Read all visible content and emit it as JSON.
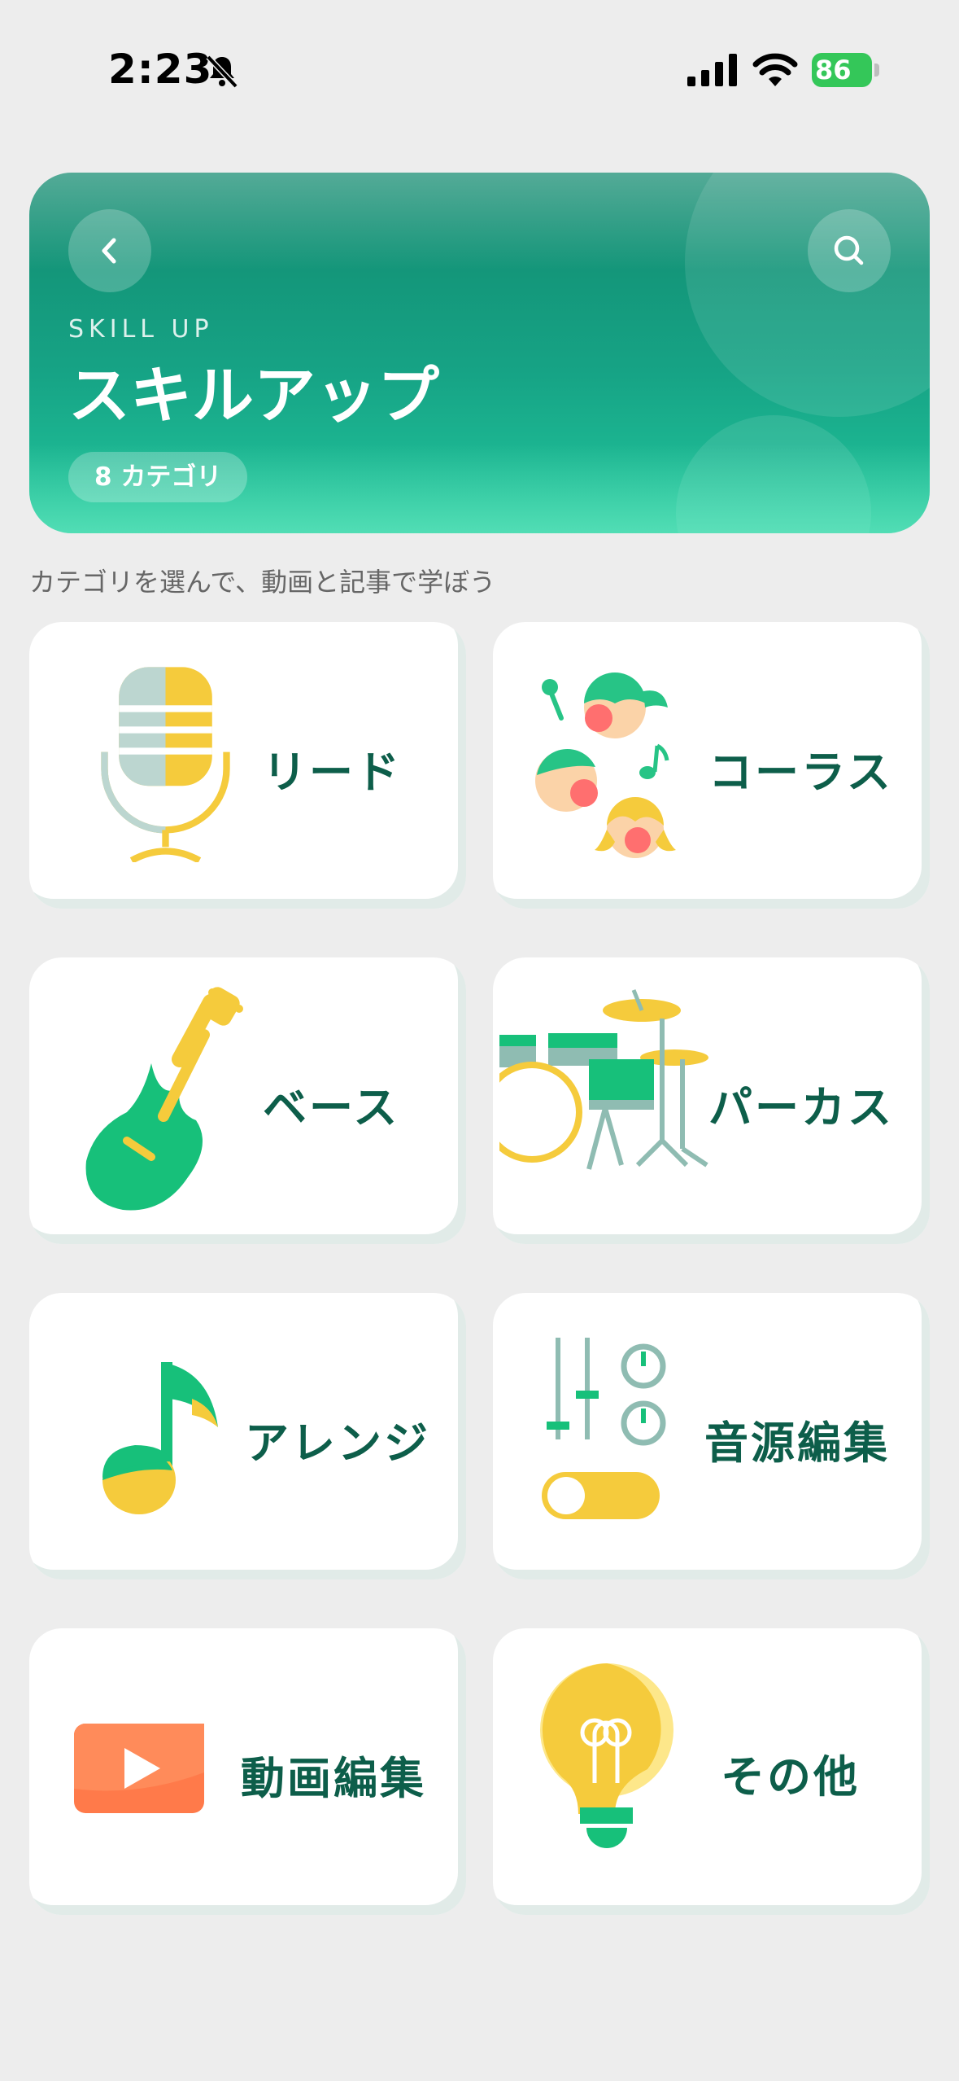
{
  "status_bar": {
    "time": "2:23",
    "battery": "86"
  },
  "hero": {
    "eyebrow": "SKILL UP",
    "title": "スキルアップ",
    "badge": "8 カテゴリ"
  },
  "caption": "カテゴリを選んで、動画と記事で学ぼう",
  "categories": [
    {
      "label": "リード",
      "icon": "microphone-icon"
    },
    {
      "label": "コーラス",
      "icon": "chorus-singers-icon"
    },
    {
      "label": "ベース",
      "icon": "bass-guitar-icon"
    },
    {
      "label": "パーカス",
      "icon": "drum-kit-icon"
    },
    {
      "label": "アレンジ",
      "icon": "music-note-icon"
    },
    {
      "label": "音源編集",
      "icon": "mixer-sliders-icon"
    },
    {
      "label": "動画編集",
      "icon": "video-play-icon"
    },
    {
      "label": "その他",
      "icon": "lightbulb-icon"
    }
  ],
  "colors": {
    "accent": "#16a385",
    "label": "#0d5e4a",
    "yellow": "#f5cb3c",
    "green": "#17c07a"
  }
}
